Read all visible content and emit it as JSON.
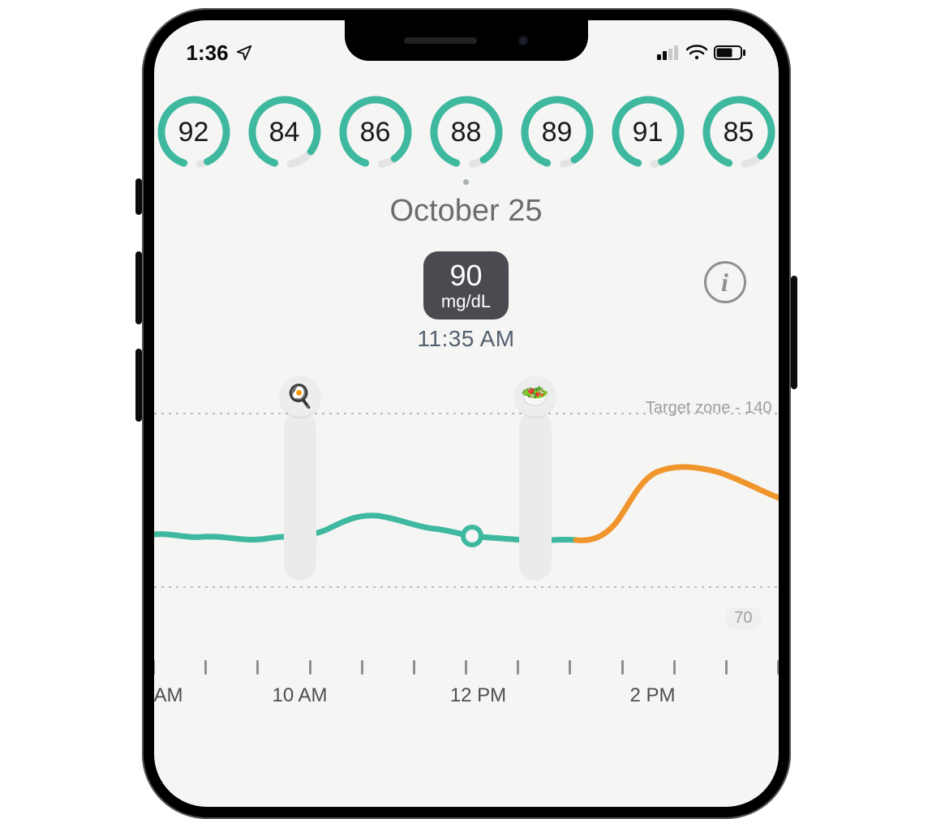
{
  "status": {
    "time": "1:36",
    "location_icon": "location-arrow",
    "signal_bars": 2,
    "wifi": true,
    "battery_pct": 60
  },
  "rings": [
    {
      "value": "92",
      "pct": 0.88
    },
    {
      "value": "84",
      "pct": 0.8
    },
    {
      "value": "86",
      "pct": 0.85
    },
    {
      "value": "88",
      "pct": 0.86
    },
    {
      "value": "89",
      "pct": 0.86
    },
    {
      "value": "91",
      "pct": 0.88
    },
    {
      "value": "85",
      "pct": 0.83
    }
  ],
  "date_label": "October 25",
  "current_reading": {
    "value": "90",
    "unit": "mg/dL",
    "time": "11:35 AM"
  },
  "info_label": "i",
  "chart": {
    "target_zone_label": "Target zone - 140",
    "low_label": "70",
    "events": [
      {
        "icon": "🍳",
        "name": "breakfast-event"
      },
      {
        "icon": "🥗",
        "name": "salad-event"
      }
    ],
    "x_ticks": [
      "AM",
      "10 AM",
      "12 PM",
      "2 PM"
    ]
  },
  "chart_data": {
    "type": "line",
    "xlabel": "",
    "ylabel": "mg/dL",
    "ylim": [
      50,
      160
    ],
    "target_zone": [
      70,
      140
    ],
    "x": [
      "8 AM",
      "8:30",
      "9",
      "9:30",
      "10",
      "10:30",
      "11",
      "11:30",
      "12",
      "12:30",
      "1",
      "1:30",
      "2",
      "2:30",
      "3"
    ],
    "series": [
      {
        "name": "in-range",
        "values": [
          92,
          90,
          93,
          91,
          95,
          100,
          98,
          94,
          90,
          89,
          92,
          95,
          null,
          null,
          null
        ],
        "color": "#3fb8a0"
      },
      {
        "name": "above-range",
        "values": [
          null,
          null,
          null,
          null,
          null,
          null,
          null,
          null,
          null,
          null,
          null,
          95,
          110,
          128,
          130
        ],
        "color": "#f0952c"
      }
    ],
    "selected_point": {
      "x": "11:35 AM",
      "y": 90
    },
    "events": [
      {
        "x": "9:45",
        "label": "breakfast"
      },
      {
        "x": "12:45",
        "label": "salad"
      }
    ]
  },
  "colors": {
    "accent": "#3fb8a0",
    "warn": "#f0952c",
    "chip_bg": "#4a4a50",
    "muted": "#9aa0a0"
  }
}
